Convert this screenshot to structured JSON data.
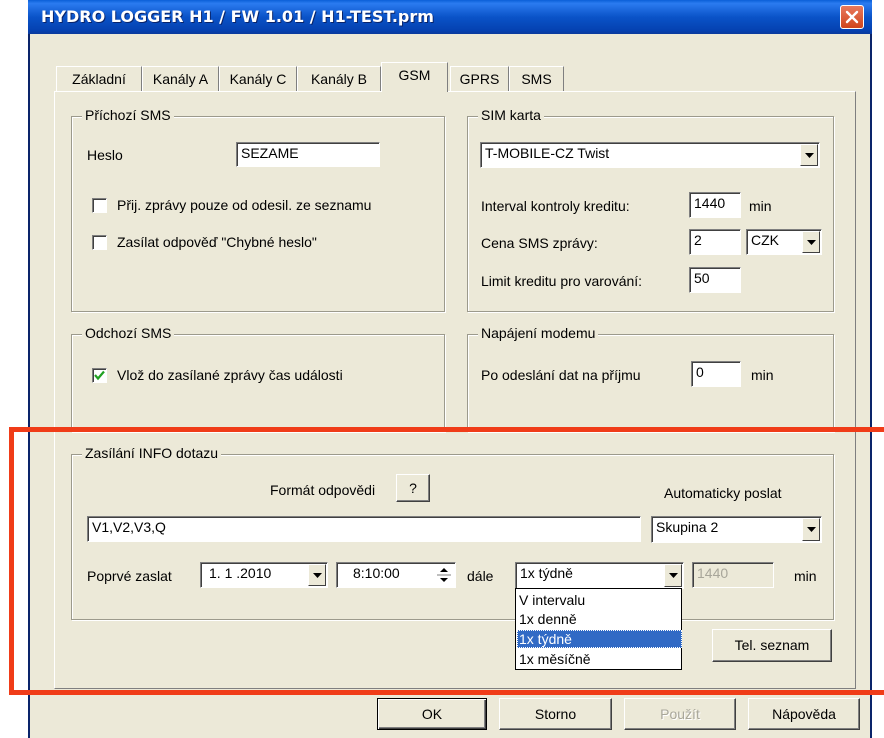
{
  "window": {
    "title": "HYDRO LOGGER H1 / FW 1.01 / H1-TEST.prm"
  },
  "tabs": [
    {
      "label": "Základní"
    },
    {
      "label": "Kanály A"
    },
    {
      "label": "Kanály C"
    },
    {
      "label": "Kanály B"
    },
    {
      "label": "GSM"
    },
    {
      "label": "GPRS"
    },
    {
      "label": "SMS"
    }
  ],
  "incoming_sms": {
    "legend": "Příchozí SMS",
    "password_label": "Heslo",
    "password_value": "SEZAME",
    "accept_only_label": "Přij. zprávy pouze od odesil. ze seznamu",
    "accept_only_checked": false,
    "send_wrong_pw_label": "Zasílat odpověď \"Chybné heslo\"",
    "send_wrong_pw_checked": false
  },
  "sim_card": {
    "legend": "SIM karta",
    "operator_value": "T-MOBILE-CZ Twist",
    "credit_interval_label": "Interval kontroly kreditu:",
    "credit_interval_value": "1440",
    "credit_interval_unit": "min",
    "sms_price_label": "Cena SMS zprávy:",
    "sms_price_value": "2",
    "currency_value": "CZK",
    "credit_limit_label": "Limit kreditu pro varování:",
    "credit_limit_value": "50"
  },
  "outgoing_sms": {
    "legend": "Odchozí SMS",
    "insert_time_label": "Vlož do zasílané zprávy čas události",
    "insert_time_checked": true
  },
  "modem_power": {
    "legend": "Napájení modemu",
    "after_send_label": "Po odeslání dat na příjmu",
    "after_send_value": "0",
    "after_send_unit": "min"
  },
  "info_query": {
    "legend": "Zasílání INFO dotazu",
    "format_label": "Formát odpovědi",
    "help_button": "?",
    "auto_send_label": "Automaticky poslat",
    "format_value": "V1,V2,V3,Q",
    "group_value": "Skupina 2",
    "first_send_label": "Poprvé zaslat",
    "date_value": "1. 1 .2010",
    "time_value": "8:10:00",
    "then_label": "dále",
    "period_value": "1x týdně",
    "interval_value": "1440",
    "interval_unit": "min",
    "period_options": [
      "V intervalu",
      "1x denně",
      "1x týdně",
      "1x měsíčně"
    ],
    "period_selected_index": 2,
    "phonebook_button": "Tel. seznam"
  },
  "footer": {
    "ok": "OK",
    "cancel": "Storno",
    "apply": "Použít",
    "help": "Nápověda"
  },
  "colors": {
    "title_bar": "#0a53c8",
    "dialog_bg": "#ece9d8",
    "highlight": "#f03c18",
    "selection": "#316ac5"
  }
}
